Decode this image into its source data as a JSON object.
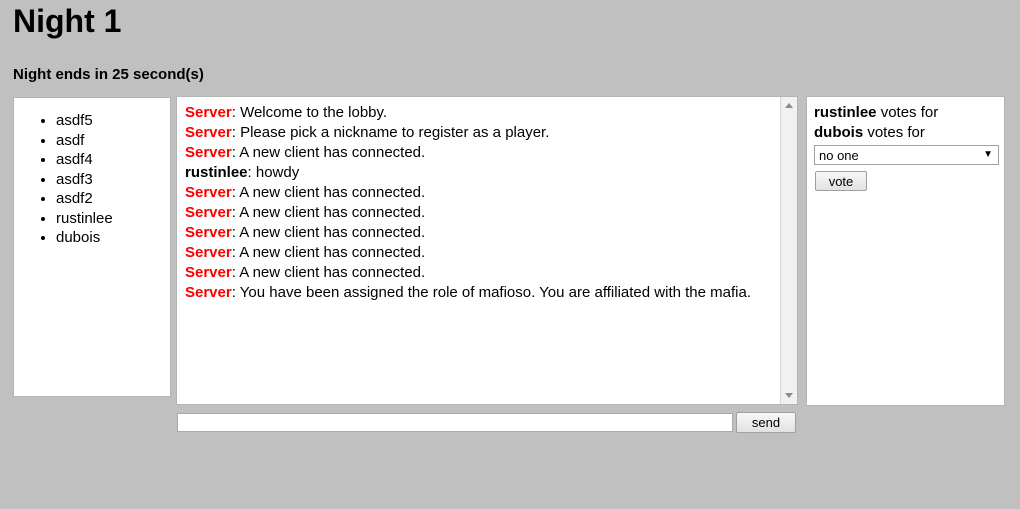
{
  "header": {
    "title": "Night 1",
    "timer_text": "Night ends in 25 second(s)"
  },
  "players": {
    "items": [
      {
        "name": "asdf5"
      },
      {
        "name": "asdf"
      },
      {
        "name": "asdf4"
      },
      {
        "name": "asdf3"
      },
      {
        "name": "asdf2"
      },
      {
        "name": "rustinlee"
      },
      {
        "name": "dubois"
      }
    ]
  },
  "chat": {
    "messages": [
      {
        "sender": "Server",
        "type": "server",
        "text": "Welcome to the lobby."
      },
      {
        "sender": "Server",
        "type": "server",
        "text": "Please pick a nickname to register as a player."
      },
      {
        "sender": "Server",
        "type": "server",
        "text": "A new client has connected."
      },
      {
        "sender": "rustinlee",
        "type": "user",
        "text": "howdy"
      },
      {
        "sender": "Server",
        "type": "server",
        "text": "A new client has connected."
      },
      {
        "sender": "Server",
        "type": "server",
        "text": "A new client has connected."
      },
      {
        "sender": "Server",
        "type": "server",
        "text": "A new client has connected."
      },
      {
        "sender": "Server",
        "type": "server",
        "text": "A new client has connected."
      },
      {
        "sender": "Server",
        "type": "server",
        "text": "A new client has connected."
      },
      {
        "sender": "Server",
        "type": "server",
        "text": "You have been assigned the role of mafioso. You are affiliated with the mafia."
      }
    ],
    "input_value": "",
    "input_placeholder": "",
    "send_label": "send",
    "scrollbar": {
      "up_arrow": "scroll-up-icon",
      "down_arrow": "scroll-down-icon"
    }
  },
  "vote_panel": {
    "lines": [
      {
        "voter": "rustinlee",
        "suffix": " votes for"
      },
      {
        "voter": "dubois",
        "suffix": " votes for"
      }
    ],
    "select_value": "no one",
    "select_caret": "▼",
    "vote_label": "vote"
  },
  "colors": {
    "background": "#c0c0c0",
    "panel": "#ffffff",
    "server_text": "#ff0000",
    "border": "#b4b4b4"
  }
}
